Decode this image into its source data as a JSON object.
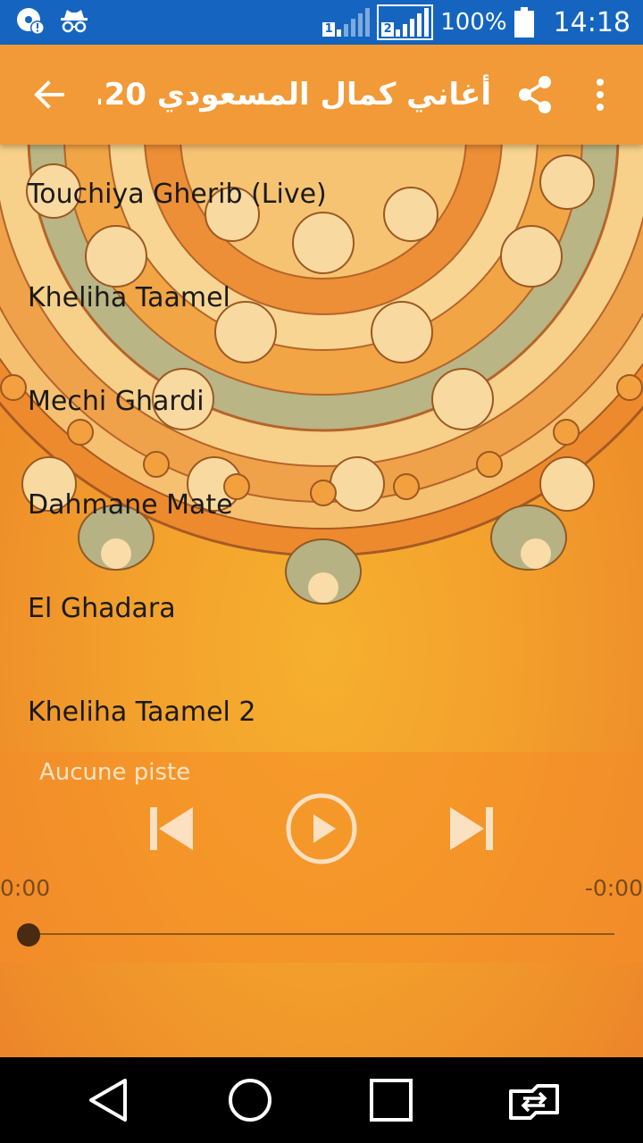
{
  "status_bar": {
    "battery_percent": "100%",
    "time": "14:18",
    "sim1_label": "1",
    "sim2_label": "2",
    "icons": [
      "media-notification-icon",
      "incognito-icon",
      "signal-sim1-icon",
      "signal-sim2-icon",
      "battery-icon"
    ]
  },
  "app_bar": {
    "title": "أغاني كمال المسعودي 20...",
    "back_icon": "arrow-left-icon",
    "share_icon": "share-icon",
    "more_icon": "more-vert-icon"
  },
  "tracks": [
    {
      "title": "Touchiya Gherib (Live)"
    },
    {
      "title": "Kheliha Taamel"
    },
    {
      "title": "Mechi Ghardi"
    },
    {
      "title": "Dahmane Mate"
    },
    {
      "title": "El Ghadara"
    },
    {
      "title": "Kheliha Taamel 2"
    }
  ],
  "player": {
    "now_playing": "Aucune piste",
    "elapsed": "0:00",
    "remaining": "-0:00",
    "progress": 0,
    "controls": [
      "skip-previous-icon",
      "play-icon",
      "skip-next-icon"
    ]
  },
  "nav_bar": {
    "icons": [
      "back-triangle-icon",
      "home-circle-icon",
      "recents-square-icon",
      "switch-app-icon"
    ]
  },
  "colors": {
    "status_bar": "#1565c0",
    "app_bar": "#f19a37",
    "background": "#f3a12c",
    "nav_bar": "#000000"
  }
}
